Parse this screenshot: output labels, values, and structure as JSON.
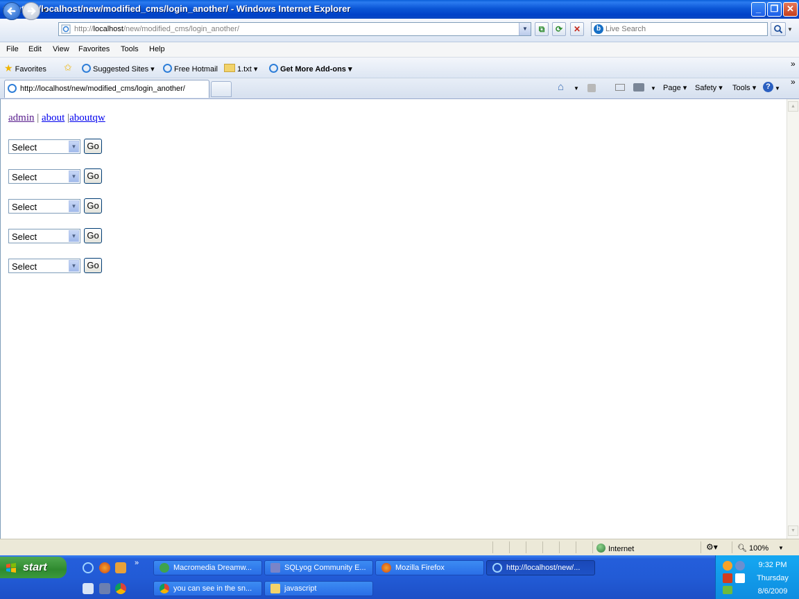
{
  "window": {
    "title": "http://localhost/new/modified_cms/login_another/ - Windows Internet Explorer",
    "minimize_label": "_",
    "maximize_label": "❐",
    "close_label": "✕"
  },
  "address": {
    "prefix": "http://",
    "host": "localhost",
    "path": "/new/modified_cms/login_another/",
    "search_placeholder": "Live Search"
  },
  "menu": [
    "File",
    "Edit",
    "View",
    "Favorites",
    "Tools",
    "Help"
  ],
  "favorites_bar": {
    "favorites_label": "Favorites",
    "items": [
      "Suggested Sites ▾",
      "Free Hotmail",
      "1.txt ▾",
      "Get More Add-ons ▾"
    ]
  },
  "tab": {
    "title": "http://localhost/new/modified_cms/login_another/"
  },
  "command_bar": {
    "page": "Page ▾",
    "safety": "Safety ▾",
    "tools": "Tools ▾"
  },
  "page": {
    "links": [
      {
        "label": "admin",
        "visited": true
      },
      {
        "label": "about",
        "visited": false
      },
      {
        "label": "aboutqw",
        "visited": false
      }
    ],
    "separator": "|",
    "forms": [
      {
        "select_value": "Select",
        "button_label": "Go"
      },
      {
        "select_value": "Select",
        "button_label": "Go"
      },
      {
        "select_value": "Select",
        "button_label": "Go"
      },
      {
        "select_value": "Select",
        "button_label": "Go"
      },
      {
        "select_value": "Select",
        "button_label": "Go"
      }
    ]
  },
  "status_bar": {
    "zone": "Internet",
    "zoom": "100%"
  },
  "taskbar": {
    "start_label": "start",
    "buttons": [
      {
        "label": "Macromedia Dreamw...",
        "active": false
      },
      {
        "label": "SQLyog Community E...",
        "active": false
      },
      {
        "label": "Mozilla Firefox",
        "active": false
      },
      {
        "label": "http://localhost/new/...",
        "active": true
      },
      {
        "label": "you can see in the sn...",
        "active": false
      },
      {
        "label": "javascript",
        "active": false
      }
    ],
    "clock": {
      "time": "9:32 PM",
      "day": "Thursday",
      "date": "8/6/2009"
    }
  },
  "colors": {
    "visited_link": "#551A8B",
    "link": "#0000EE",
    "titlebar": "#0A5FD8",
    "taskbar": "#245EDB",
    "start_green": "#3B9A3B"
  }
}
